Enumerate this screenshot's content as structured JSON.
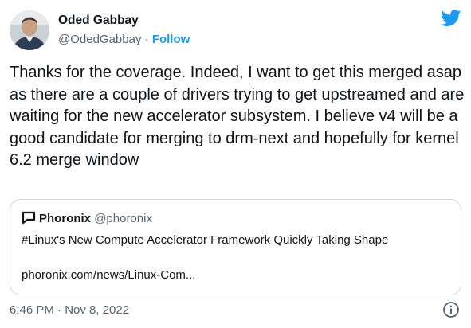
{
  "author": {
    "name": "Oded Gabbay",
    "handle": "@OdedGabbay",
    "separator": "·",
    "follow_label": "Follow"
  },
  "tweet": {
    "text": "Thanks for the coverage. Indeed, I want to get this merged asap as there are a couple of drivers trying to get upstreamed and are waiting for the new accelerator subsystem. I believe v4 will be a good candidate for merging to drm-next and hopefully for kernel 6.2 merge window",
    "timestamp": "6:46 PM · Nov 8, 2022"
  },
  "quoted_tweet": {
    "name": "Phoronix",
    "handle": "@phoronix",
    "title": "#Linux's New Compute Accelerator Framework Quickly Taking Shape",
    "link": "phoronix.com/news/Linux-Com..."
  },
  "icons": {
    "brand": "twitter-bird-icon",
    "quote": "phoronix-speech-icon",
    "info": "info-icon"
  },
  "colors": {
    "accent": "#1d9bf0",
    "text": "#0f1419",
    "muted": "#536471",
    "border": "#cfd9de"
  }
}
